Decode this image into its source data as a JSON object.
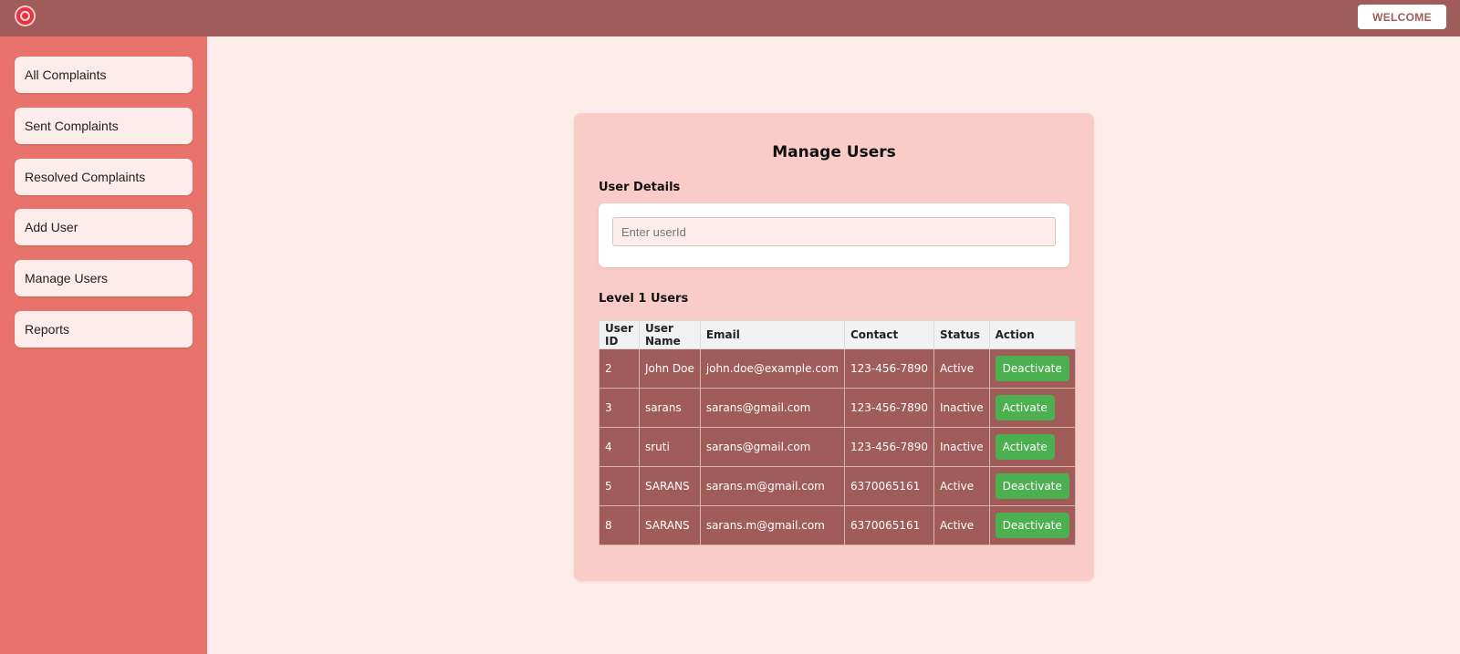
{
  "header": {
    "logo": "railway-logo-icon",
    "welcome_label": "WELCOME"
  },
  "sidebar": {
    "items": [
      {
        "label": "All Complaints"
      },
      {
        "label": "Sent Complaints"
      },
      {
        "label": "Resolved Complaints"
      },
      {
        "label": "Add User"
      },
      {
        "label": "Manage Users"
      },
      {
        "label": "Reports"
      }
    ]
  },
  "main": {
    "title": "Manage Users",
    "user_details_label": "User Details",
    "user_input": {
      "placeholder": "Enter userId",
      "value": ""
    },
    "level_label": "Level 1 Users",
    "table": {
      "headers": [
        "User ID",
        "User Name",
        "Email",
        "Contact",
        "Status",
        "Action"
      ],
      "rows": [
        {
          "id": "2",
          "name": "John Doe",
          "email": "john.doe@example.com",
          "contact": "123-456-7890",
          "status": "Active",
          "action": "Deactivate"
        },
        {
          "id": "3",
          "name": "sarans",
          "email": "sarans@gmail.com",
          "contact": "123-456-7890",
          "status": "Inactive",
          "action": "Activate"
        },
        {
          "id": "4",
          "name": "sruti",
          "email": "sarans@gmail.com",
          "contact": "123-456-7890",
          "status": "Inactive",
          "action": "Activate"
        },
        {
          "id": "5",
          "name": "SARANS",
          "email": "sarans.m@gmail.com",
          "contact": "6370065161",
          "status": "Active",
          "action": "Deactivate"
        },
        {
          "id": "8",
          "name": "SARANS",
          "email": "sarans.m@gmail.com",
          "contact": "6370065161",
          "status": "Active",
          "action": "Deactivate"
        }
      ]
    }
  },
  "colors": {
    "topbar": "#a05c58",
    "sidebar": "#e8736c",
    "page_bg": "#fcecea",
    "card_bg": "#f9ccc7",
    "row_bg": "#a05c58",
    "action_button": "#4caf50"
  }
}
